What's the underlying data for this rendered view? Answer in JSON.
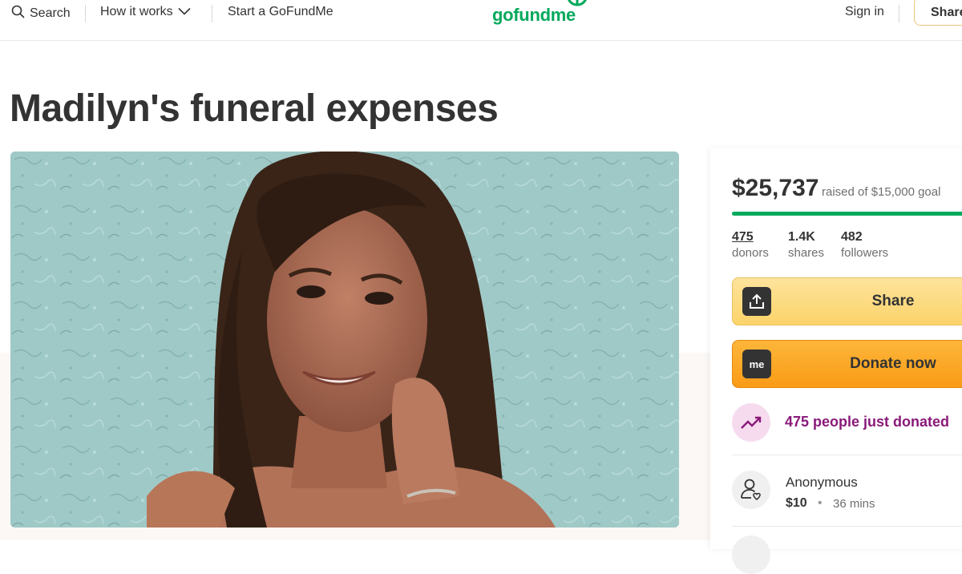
{
  "header": {
    "search_label": "Search",
    "how_label": "How it works",
    "start_label": "Start a GoFundMe",
    "logo_text": "gofundme",
    "signin_label": "Sign in",
    "share_label": "Share"
  },
  "campaign": {
    "title": "Madilyn's funeral expenses"
  },
  "sidebar": {
    "raised": "$25,737",
    "goal_text": "raised of $15,000 goal",
    "progress_fraction": 1.0,
    "stats": [
      {
        "value": "475",
        "label": "donors"
      },
      {
        "value": "1.4K",
        "label": "shares"
      },
      {
        "value": "482",
        "label": "followers"
      }
    ],
    "share_button": "Share",
    "donate_button": "Donate now",
    "donate_icon_text": "me",
    "trend_text": "475 people just donated",
    "donation": {
      "name": "Anonymous",
      "amount": "$10",
      "separator": "•",
      "time": "36 mins"
    }
  },
  "colors": {
    "brand_green": "#02a95c",
    "share_yellow": "#fcd36a",
    "donate_orange": "#f99b16",
    "trend_purple": "#8a1a7a"
  },
  "icons": [
    "search-icon",
    "chevron-down-icon",
    "share-upload-icon",
    "gofundme-me-icon",
    "trending-up-icon",
    "donor-heart-icon"
  ]
}
